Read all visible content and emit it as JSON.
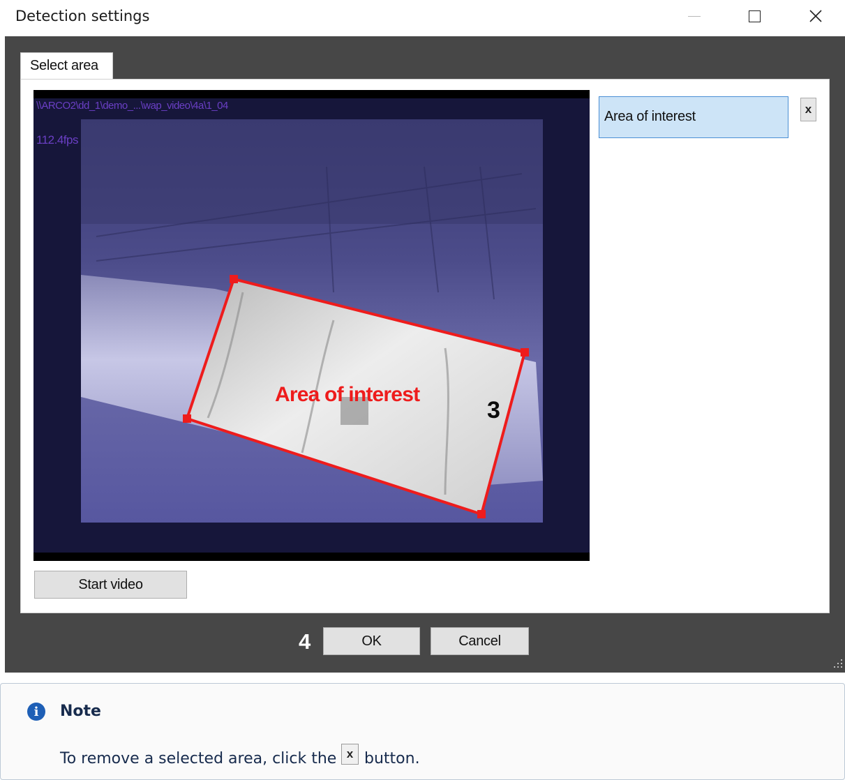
{
  "window": {
    "title": "Detection settings",
    "minimize_icon": "minimize-icon",
    "maximize_icon": "maximize-icon",
    "close_icon": "close-icon"
  },
  "tabs": [
    {
      "label": "Select area",
      "active": true
    }
  ],
  "video": {
    "path_overlay": "\\\\ARCO2\\dd_1\\demo_...\\wap_video\\4a\\1_04",
    "fps_overlay": "112.4fps"
  },
  "region": {
    "label": "Area of interest",
    "color": "#ee1c1c"
  },
  "area_list": {
    "items": [
      {
        "label": "Area of interest",
        "selected": true
      }
    ],
    "remove_label": "x"
  },
  "buttons": {
    "start_video": "Start video",
    "ok": "OK",
    "cancel": "Cancel"
  },
  "callouts": {
    "region": "3",
    "ok": "4"
  },
  "note": {
    "icon": "info-icon",
    "title": "Note",
    "text_before": "To remove a selected area, click the",
    "button_glyph": "x",
    "text_after": "button."
  },
  "colors": {
    "dialog_bg": "#474747",
    "selection_bg": "#cde4f7",
    "selection_border": "#4a8fd4",
    "note_icon": "#1e5fb6"
  }
}
